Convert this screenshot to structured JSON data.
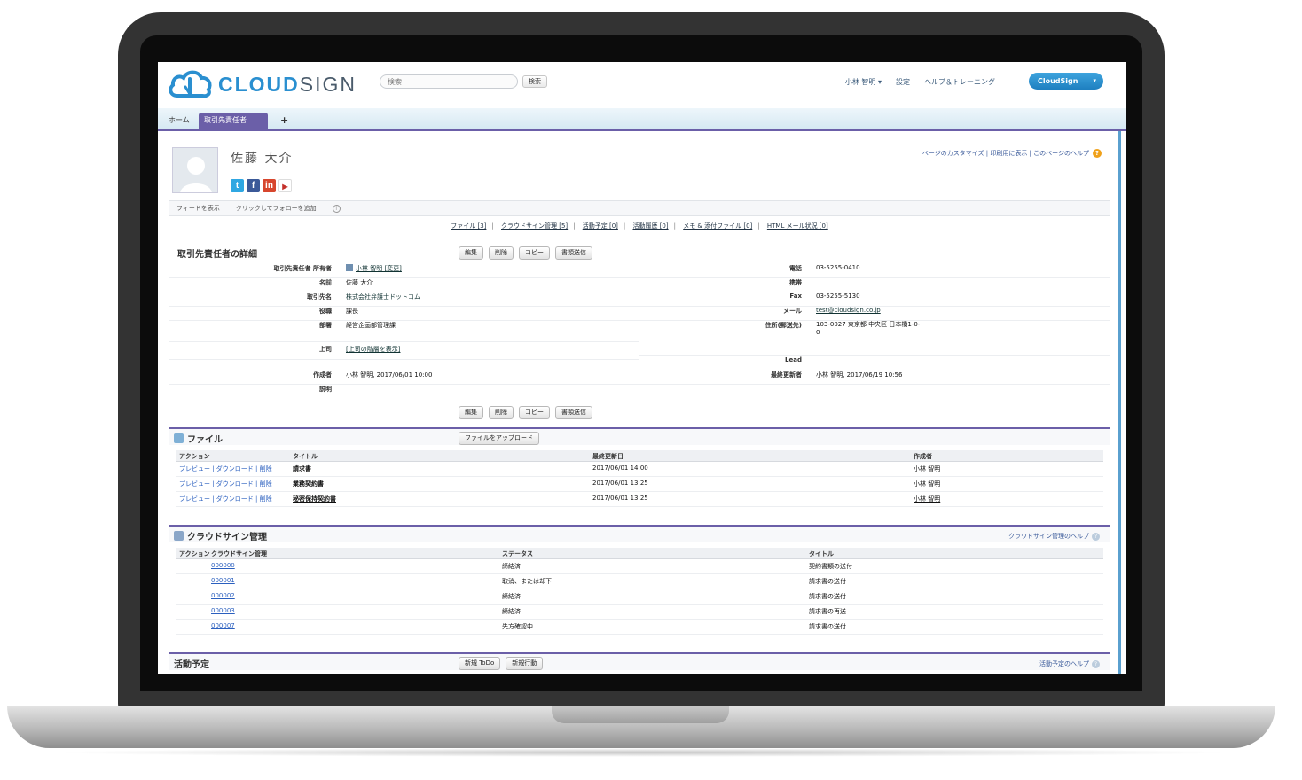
{
  "header": {
    "logo_prefix": "CLOUD",
    "logo_suffix": "SIGN",
    "search_placeholder": "検索",
    "search_button": "検索",
    "nav": [
      "小林 智明 ▾",
      "設定",
      "ヘルプ＆トレーニング"
    ],
    "app_button": "CloudSign",
    "app_caret": "▾"
  },
  "tabs": {
    "home": "ホーム",
    "active": "取引先責任者",
    "plus": "+"
  },
  "person": {
    "name": "佐藤 大介",
    "social_icons": [
      "twitter-icon",
      "facebook-icon",
      "linkedin-icon",
      "youtube-icon"
    ],
    "page_help": "ページのカスタマイズ | 印刷用に表示 | このページのヘルプ",
    "help_glyph": "?"
  },
  "feedbar": {
    "show_feed": "フィードを表示",
    "follow": "クリックしてフォローを追加",
    "info_glyph": "i"
  },
  "related_links": [
    "ファイル [3]",
    "クラウドサイン管理 [5]",
    "活動予定 [0]",
    "活動履歴 [0]",
    "メモ & 添付ファイル [0]",
    "HTML メール状況 [0]"
  ],
  "related_sep": "|",
  "detail": {
    "title": "取引先責任者の詳細",
    "buttons": [
      "編集",
      "削除",
      "コピー",
      "書類送信"
    ],
    "left_fields": [
      {
        "label": "取引先責任者 所有者",
        "value": "小林 智明 [変更]",
        "link": true
      },
      {
        "label": "名前",
        "value": "佐藤 大介",
        "link": false
      },
      {
        "label": "取引先名",
        "value": "株式会社弁護士ドットコム",
        "link": true
      },
      {
        "label": "役職",
        "value": "課長",
        "link": false
      },
      {
        "label": "部署",
        "value": "経営企画部管理課",
        "link": false
      },
      {
        "label": "上司",
        "value": "[上司の階層を表示]",
        "link": true
      },
      {
        "label": "作成者",
        "value": "小林 智明, 2017/06/01 10:00",
        "link": false
      },
      {
        "label": "説明",
        "value": "",
        "link": false
      }
    ],
    "right_fields": [
      {
        "label": "電話",
        "value": "03-5255-0410",
        "link": false
      },
      {
        "label": "携帯",
        "value": "",
        "link": false
      },
      {
        "label": "Fax",
        "value": "03-5255-5130",
        "link": false
      },
      {
        "label": "メール",
        "value": "test@cloudsign.co.jp",
        "link": true
      },
      {
        "label": "住所(郵送先)",
        "value": "103-0027 東京都 中央区 日本橋1-0-0",
        "link": false
      },
      {
        "label": "Lead",
        "value": "",
        "link": false
      },
      {
        "label": "最終更新者",
        "value": "小林 智明, 2017/06/19 10:56",
        "link": false
      }
    ]
  },
  "files": {
    "title": "ファイル",
    "upload_button": "ファイルをアップロード",
    "columns": [
      "アクション",
      "タイトル",
      "最終更新日",
      "作成者"
    ],
    "rows": [
      {
        "action": "プレビュー | ダウンロード | 削除",
        "title": "請求書",
        "updated": "2017/06/01 14:00",
        "owner": "小林 智明"
      },
      {
        "action": "プレビュー | ダウンロード | 削除",
        "title": "業務契約書",
        "updated": "2017/06/01 13:25",
        "owner": "小林 智明"
      },
      {
        "action": "プレビュー | ダウンロード | 削除",
        "title": "秘密保持契約書",
        "updated": "2017/06/01 13:25",
        "owner": "小林 智明"
      }
    ]
  },
  "cloudsign": {
    "title": "クラウドサイン管理",
    "help": "クラウドサイン管理のヘルプ",
    "columns": [
      "アクション",
      "クラウドサイン管理",
      "ステータス",
      "タイトル"
    ],
    "rows": [
      {
        "id": "000000",
        "status": "締結済",
        "title": "契約書類の送付"
      },
      {
        "id": "000001",
        "status": "取消、または却下",
        "title": "請求書の送付"
      },
      {
        "id": "000002",
        "status": "締結済",
        "title": "請求書の送付"
      },
      {
        "id": "000003",
        "status": "締結済",
        "title": "請求書の再送"
      },
      {
        "id": "000007",
        "status": "先方確認中",
        "title": "請求書の送付"
      }
    ]
  },
  "activities": {
    "title": "活動予定",
    "buttons": [
      "新規 ToDo",
      "新規行動"
    ],
    "help": "活動予定のヘルプ"
  },
  "colors": {
    "brand_blue": "#2a8fd0",
    "tab_purple": "#6b5fa8",
    "link_blue": "#2a5fbf"
  }
}
